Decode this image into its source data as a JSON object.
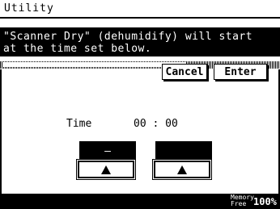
{
  "window": {
    "title": "Utility"
  },
  "message": {
    "line1": "\"Scanner Dry\" (dehumidify) will start",
    "line2": "at the time set below."
  },
  "buttons": {
    "cancel": "Cancel",
    "enter": "Enter"
  },
  "time": {
    "label": "Time",
    "value": "00 : 00",
    "hour_field": "–",
    "minute_field": ""
  },
  "footer": {
    "memory_label_1": "Memory",
    "memory_label_2": "Free",
    "memory_value": "100%"
  },
  "icons": {
    "hour_up": "triangle-up-icon",
    "minute_up": "triangle-up-icon"
  }
}
